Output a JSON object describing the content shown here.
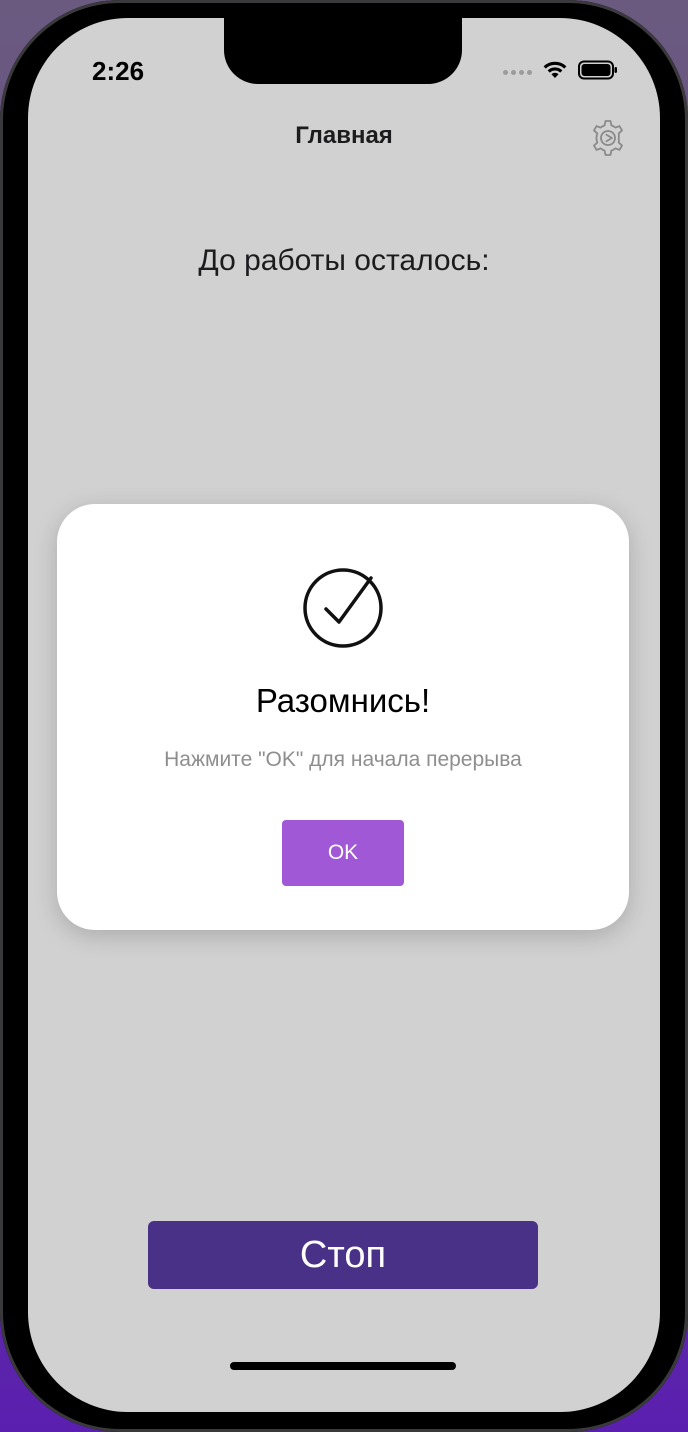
{
  "status_bar": {
    "time": "2:26",
    "icons": [
      "signal-dots-icon",
      "wifi-icon",
      "battery-icon"
    ]
  },
  "nav": {
    "title": "Главная",
    "settings_icon": "gear-icon"
  },
  "main": {
    "countdown_label": "До работы осталось:",
    "stop_label": "Стоп"
  },
  "dialog": {
    "icon": "checkmark-circle-icon",
    "title": "Разомнись!",
    "message": "Нажмите \"OK\" для начала перерыва",
    "ok_label": "OK"
  },
  "colors": {
    "screen_background": "#d1d1d1",
    "accent_ok": "#a158d6",
    "accent_stop": "#4a3188"
  }
}
